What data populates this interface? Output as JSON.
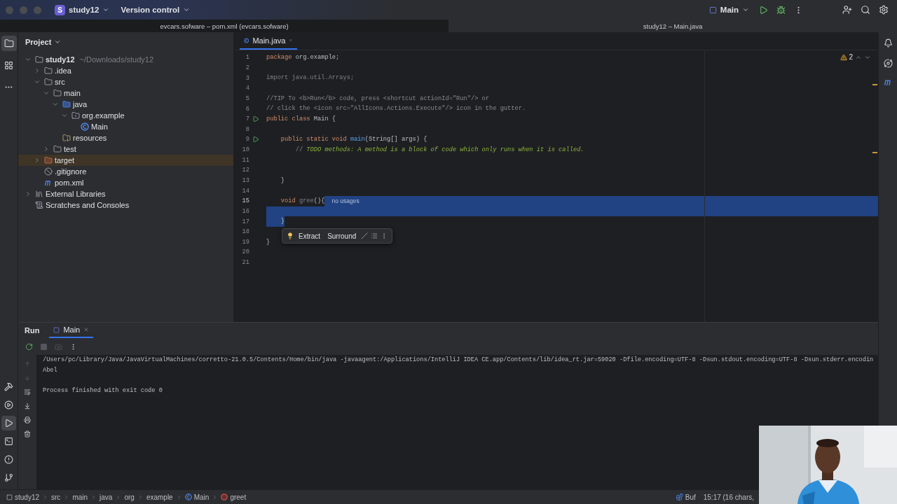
{
  "title_bar": {
    "project_badge": "S",
    "project": "study12",
    "vcs": "Version control",
    "run_config": "Main"
  },
  "window_tabs": [
    {
      "title": "evcars.sofware – pom.xml (evcars.sofware)",
      "selected": false
    },
    {
      "title": "study12 – Main.java",
      "selected": true
    }
  ],
  "project_panel": {
    "title": "Project",
    "tree": [
      {
        "label": "study12",
        "hint": "~/Downloads/study12",
        "kind": "module",
        "expanded": true,
        "selected": false,
        "children": [
          {
            "label": ".idea",
            "kind": "folder",
            "expanded": false,
            "selected": false
          },
          {
            "label": "src",
            "kind": "folder",
            "expanded": true,
            "selected": false,
            "children": [
              {
                "label": "main",
                "kind": "folder",
                "expanded": true,
                "selected": false,
                "children": [
                  {
                    "label": "java",
                    "kind": "source",
                    "expanded": true,
                    "selected": false,
                    "children": [
                      {
                        "label": "org.example",
                        "kind": "package",
                        "expanded": true,
                        "selected": false,
                        "children": [
                          {
                            "label": "Main",
                            "kind": "class",
                            "selected": false
                          }
                        ]
                      }
                    ]
                  },
                  {
                    "label": "resources",
                    "kind": "resources",
                    "selected": false
                  }
                ]
              },
              {
                "label": "test",
                "kind": "folder",
                "expanded": false,
                "selected": false
              }
            ]
          },
          {
            "label": "target",
            "kind": "excluded",
            "expanded": false,
            "selected": true
          },
          {
            "label": ".gitignore",
            "kind": "ignore",
            "selected": false
          },
          {
            "label": "pom.xml",
            "kind": "maven",
            "selected": false
          }
        ]
      },
      {
        "label": "External Libraries",
        "kind": "libraries",
        "expanded": false,
        "selected": false
      },
      {
        "label": "Scratches and Consoles",
        "kind": "scratches",
        "selected": false
      }
    ]
  },
  "editor": {
    "tabs": [
      {
        "label": "Main.java",
        "selected": true
      }
    ],
    "warnings": "2",
    "popup": {
      "actions": [
        "Extract",
        "Surround"
      ]
    },
    "lines": [
      {
        "number": "1",
        "tokens": [
          {
            "text": "package",
            "kind": "kw"
          },
          {
            "text": " org.example;",
            "kind": "plain"
          }
        ],
        "run": false,
        "current": false,
        "selected": false
      },
      {
        "number": "2",
        "run": false,
        "current": false,
        "selected": false
      },
      {
        "number": "3",
        "tokens": [
          {
            "text": "import java.util.Arrays;",
            "kind": "unused"
          }
        ],
        "run": false,
        "current": false,
        "selected": false
      },
      {
        "number": "4",
        "run": false,
        "current": false,
        "selected": false
      },
      {
        "number": "5",
        "tokens": [
          {
            "text": "//TIP To <b>Run</b> code, press <shortcut actionId=\"Run\"/> or",
            "kind": "comment"
          }
        ],
        "run": false,
        "current": false,
        "selected": false
      },
      {
        "number": "6",
        "tokens": [
          {
            "text": "// click the <icon src=\"AllIcons.Actions.Execute\"/> icon in the gutter.",
            "kind": "comment"
          }
        ],
        "run": false,
        "current": false,
        "selected": false
      },
      {
        "number": "7",
        "tokens": [
          {
            "text": "public class ",
            "kind": "kw"
          },
          {
            "text": "Main {",
            "kind": "plain"
          }
        ],
        "run": true,
        "current": false,
        "selected": false
      },
      {
        "number": "8",
        "run": false,
        "current": false,
        "selected": false
      },
      {
        "number": "9",
        "tokens": [
          {
            "text": "    public static void ",
            "kind": "kw"
          },
          {
            "text": "main",
            "kind": "fn"
          },
          {
            "text": "(String[] args) {",
            "kind": "plain"
          }
        ],
        "run": true,
        "current": false,
        "selected": false
      },
      {
        "number": "10",
        "tokens": [
          {
            "text": "        // ",
            "kind": "comment"
          },
          {
            "text": "TODO methods: A method is a block of code which only runs when it is called.",
            "kind": "todo"
          }
        ],
        "run": false,
        "current": false,
        "selected": false
      },
      {
        "number": "11",
        "run": false,
        "current": false,
        "selected": false
      },
      {
        "number": "12",
        "run": false,
        "current": false,
        "selected": false
      },
      {
        "number": "13",
        "tokens": [
          {
            "text": "    }",
            "kind": "plain"
          }
        ],
        "run": false,
        "current": false,
        "selected": false
      },
      {
        "number": "14",
        "run": false,
        "current": false,
        "selected": false
      },
      {
        "number": "15",
        "tokens": [
          {
            "text": "    void ",
            "kind": "kw"
          },
          {
            "text": "gree",
            "kind": "unused"
          },
          {
            "text": "(){",
            "kind": "plain"
          }
        ],
        "hint": "no usages",
        "run": false,
        "current": true,
        "selected": true
      },
      {
        "number": "16",
        "run": false,
        "current": false,
        "selected": true
      },
      {
        "number": "17",
        "tokens": [
          {
            "text": "    }",
            "kind": "plain"
          }
        ],
        "run": false,
        "current": false,
        "selected": true
      },
      {
        "number": "18",
        "run": false,
        "current": false,
        "selected": false
      },
      {
        "number": "19",
        "tokens": [
          {
            "text": "}",
            "kind": "plain"
          }
        ],
        "run": false,
        "current": false,
        "selected": false
      },
      {
        "number": "20",
        "run": false,
        "current": false,
        "selected": false
      },
      {
        "number": "21",
        "run": false,
        "current": false,
        "selected": false
      }
    ]
  },
  "run_panel": {
    "title": "Run",
    "tabs": [
      {
        "label": "Main",
        "selected": true
      }
    ],
    "output": [
      {
        "text": "/Users/pc/Library/Java/JavaVirtualMachines/corretto-21.0.5/Contents/Home/bin/java -javaagent:/Applications/IntelliJ IDEA CE.app/Contents/lib/idea_rt.jar=59020 -Dfile.encoding=UTF-8 -Dsun.stdout.encoding=UTF-8 -Dsun.stderr.encodin",
        "kind": "command"
      },
      {
        "text": "Abel",
        "kind": "output"
      },
      {
        "text": "Process finished with exit code 0",
        "kind": "exit"
      }
    ]
  },
  "status_bar": {
    "breadcrumbs": [
      {
        "label": "study12",
        "kind": "module"
      },
      {
        "label": "src",
        "kind": "dir"
      },
      {
        "label": "main",
        "kind": "dir"
      },
      {
        "label": "java",
        "kind": "dir"
      },
      {
        "label": "org",
        "kind": "dir"
      },
      {
        "label": "example",
        "kind": "dir"
      },
      {
        "label": "Main",
        "kind": "class"
      },
      {
        "label": "greet",
        "kind": "method"
      }
    ],
    "indicator": "Buf",
    "position": "15:17 (16 chars,"
  }
}
